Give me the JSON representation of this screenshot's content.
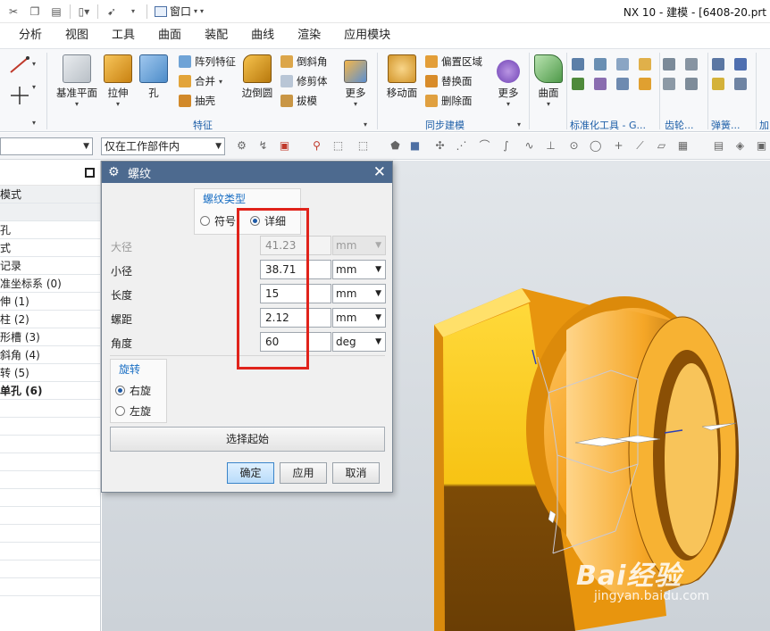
{
  "titlebar": {
    "window_menu_label": "窗口",
    "app_title": "NX 10 - 建模 - [6408-20.prt"
  },
  "tabs": [
    "分析",
    "视图",
    "工具",
    "曲面",
    "装配",
    "曲线",
    "渲染",
    "应用模块"
  ],
  "ribbon": {
    "feature_buttons": [
      "基准平面",
      "拉伸",
      "孔"
    ],
    "feature_small": [
      "阵列特征",
      "合并",
      "抽壳"
    ],
    "edge_blend": "边倒圆",
    "feature_small2": [
      "倒斜角",
      "修剪体",
      "拔模"
    ],
    "more": "更多",
    "feature_group_label": "特征",
    "move_face": "移动面",
    "sync_small": [
      "偏置区域",
      "替换面",
      "删除面"
    ],
    "sync_more": "更多",
    "sync_group_label": "同步建模",
    "surface": "曲面",
    "std_group_label": "标准化工具 - G...",
    "gear_group_label": "齿轮...",
    "spring_group_label": "弹簧...",
    "add_group_label": "加"
  },
  "selbar": {
    "scope_value": "仅在工作部件内"
  },
  "navigator": {
    "rows": [
      {
        "text": "模式",
        "style": "sub"
      },
      {
        "text": "",
        "style": "sub"
      },
      {
        "text": "孔",
        "style": ""
      },
      {
        "text": "式",
        "style": ""
      },
      {
        "text": "记录",
        "style": ""
      },
      {
        "text": "准坐标系 (0)",
        "style": ""
      },
      {
        "text": "伸 (1)",
        "style": ""
      },
      {
        "text": "柱 (2)",
        "style": ""
      },
      {
        "text": "形槽 (3)",
        "style": ""
      },
      {
        "text": "斜角 (4)",
        "style": ""
      },
      {
        "text": "转 (5)",
        "style": ""
      },
      {
        "text": "单孔 (6)",
        "style": "bold"
      },
      {
        "text": "",
        "style": ""
      },
      {
        "text": "",
        "style": ""
      },
      {
        "text": "",
        "style": ""
      },
      {
        "text": "",
        "style": ""
      },
      {
        "text": "",
        "style": ""
      },
      {
        "text": "",
        "style": ""
      },
      {
        "text": "",
        "style": ""
      },
      {
        "text": "",
        "style": ""
      },
      {
        "text": "",
        "style": ""
      },
      {
        "text": "",
        "style": ""
      },
      {
        "text": "",
        "style": ""
      }
    ]
  },
  "dialog": {
    "title": "螺纹",
    "thread_type_label": "螺纹类型",
    "option_symbolic": "符号",
    "option_detailed": "详细",
    "selected_type": "详细",
    "fields": [
      {
        "label": "大径",
        "value": "41.23",
        "unit": "mm",
        "disabled": true
      },
      {
        "label": "小径",
        "value": "38.71",
        "unit": "mm",
        "disabled": false
      },
      {
        "label": "长度",
        "value": "15",
        "unit": "mm",
        "disabled": false
      },
      {
        "label": "螺距",
        "value": "2.12",
        "unit": "mm",
        "disabled": false
      },
      {
        "label": "角度",
        "value": "60",
        "unit": "deg",
        "disabled": false
      }
    ],
    "rotation_label": "旋转",
    "rotation_right": "右旋",
    "rotation_left": "左旋",
    "selected_rotation": "右旋",
    "select_start": "选择起始",
    "ok": "确定",
    "apply": "应用",
    "cancel": "取消"
  },
  "watermark": {
    "brand": "Bai经验",
    "url": "jingyan.baidu.com"
  },
  "colors": {
    "dialog_title_bg": "#4d6a8f",
    "highlight": "#e0231b",
    "model_gold": "#f2a10d",
    "model_dark": "#7a4a08"
  }
}
